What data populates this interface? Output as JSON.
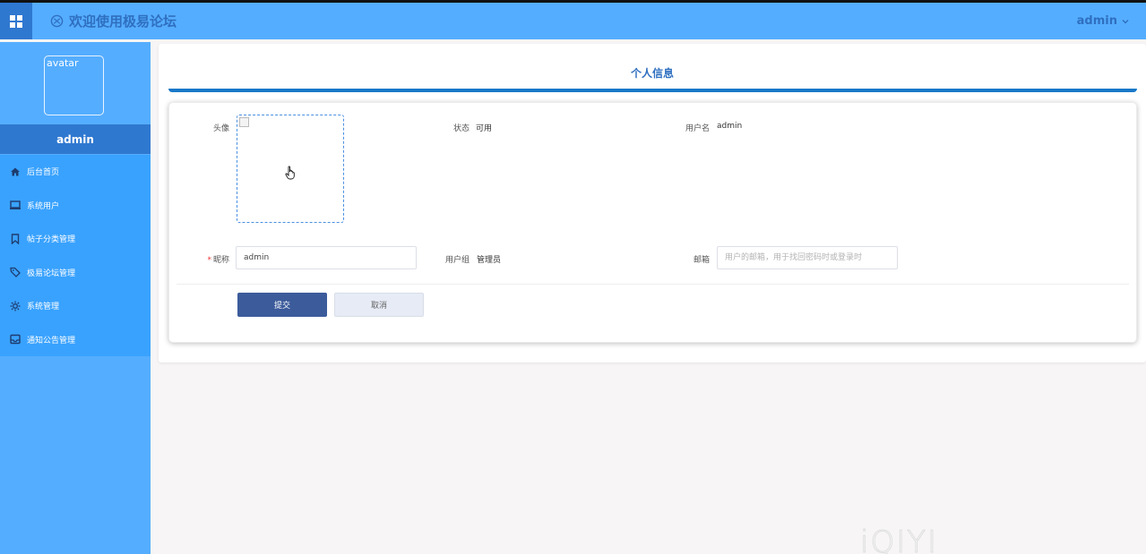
{
  "header": {
    "title": "欢迎使用极易论坛",
    "user": "admin"
  },
  "sidebar": {
    "avatar_alt": "avatar",
    "username": "admin",
    "items": [
      {
        "label": "后台首页",
        "icon": "home-icon"
      },
      {
        "label": "系统用户",
        "icon": "monitor-icon"
      },
      {
        "label": "帖子分类管理",
        "icon": "bookmark-icon"
      },
      {
        "label": "极易论坛管理",
        "icon": "tag-icon"
      },
      {
        "label": "系统管理",
        "icon": "gear-icon"
      },
      {
        "label": "通知公告管理",
        "icon": "inbox-icon"
      }
    ]
  },
  "profile": {
    "title": "个人信息",
    "avatar_label": "头像",
    "status_label": "状态",
    "status_value": "可用",
    "username_label": "用户名",
    "username_value": "admin",
    "nickname_label": "昵称",
    "nickname_value": "admin",
    "group_label": "用户组",
    "group_value": "管理员",
    "email_label": "邮箱",
    "email_placeholder": "用户的邮箱，用于找回密码时或登录时",
    "submit": "提交",
    "cancel": "取消"
  },
  "watermark": "iQIYI",
  "colors": {
    "topbar": "#55adff",
    "sidebar": "#55adff",
    "menu": "#39a2ff",
    "accent_dark": "#2f78d0",
    "submit_button": "#3b5b9b"
  }
}
